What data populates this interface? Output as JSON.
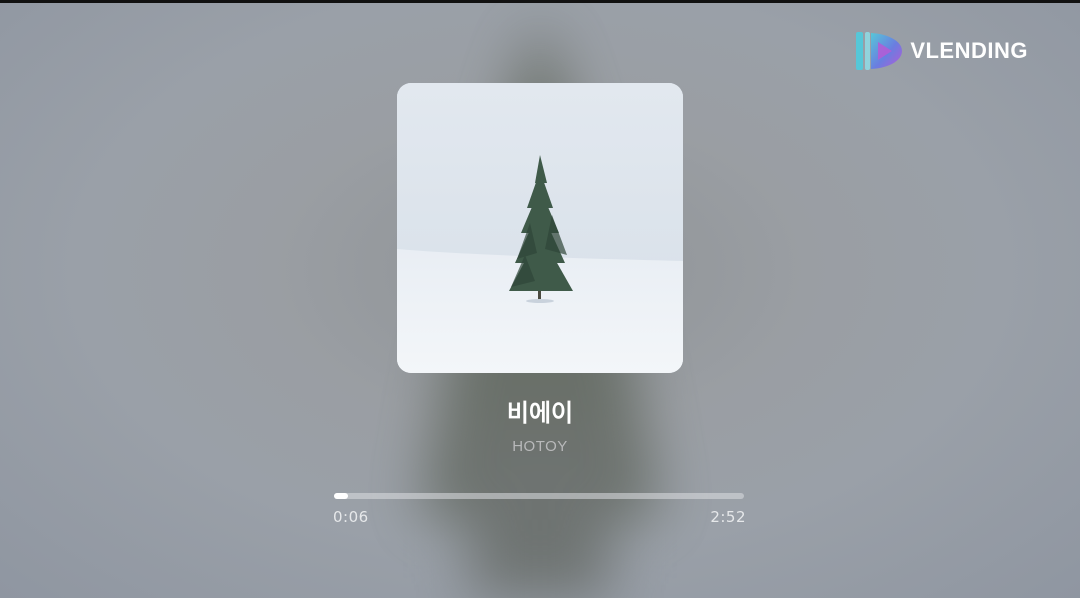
{
  "brand": {
    "name": "VLENDING",
    "icon": "vlending-play-logo-icon",
    "colors": [
      "#56c7d8",
      "#6a7de0",
      "#b55ad6"
    ]
  },
  "album_art": {
    "icon": "winter-tree-album-art"
  },
  "track": {
    "title": "비에이",
    "artist": "HOTOY"
  },
  "playback": {
    "elapsed": "0:06",
    "total": "2:52",
    "progress_fraction": 0.035
  },
  "colors": {
    "background": "#9a9ea3",
    "accent": "#ffffff"
  }
}
